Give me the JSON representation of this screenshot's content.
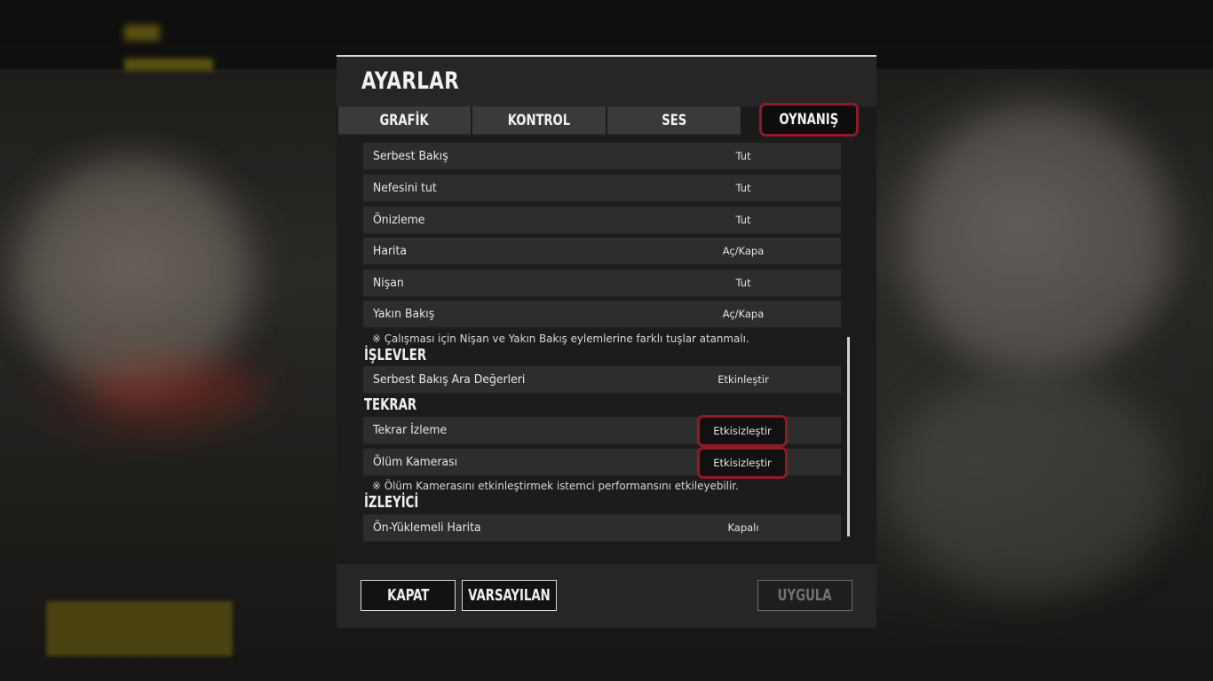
{
  "dialog": {
    "title": "AYARLAR"
  },
  "tabs": [
    {
      "label": "GRAFİK",
      "active": false
    },
    {
      "label": "KONTROL",
      "active": false
    },
    {
      "label": "SES",
      "active": false
    },
    {
      "label": "OYNANIŞ",
      "active": true
    }
  ],
  "rows": [
    {
      "name": "Serbest Bakış",
      "value": "Tut"
    },
    {
      "name": "Nefesini tut",
      "value": "Tut"
    },
    {
      "name": "Önizleme",
      "value": "Tut"
    },
    {
      "name": "Harita",
      "value": "Aç/Kapa"
    },
    {
      "name": "Nişan",
      "value": "Tut"
    },
    {
      "name": "Yakın Bakış",
      "value": "Aç/Kapa"
    }
  ],
  "note1": "※ Çalışması için Nişan ve Yakın Bakış eylemlerine farklı tuşlar atanmalı.",
  "sections": {
    "islevler": {
      "title": "İŞLEVLER",
      "rows": [
        {
          "name": "Serbest Bakış Ara Değerleri",
          "value": "Etkinleştir"
        }
      ]
    },
    "tekrar": {
      "title": "TEKRAR",
      "rows": [
        {
          "name": "Tekrar İzleme",
          "value": "Etkisizleştir"
        },
        {
          "name": "Ölüm Kamerası",
          "value": "Etkisizleştir"
        }
      ]
    },
    "izleyici": {
      "title": "İZLEYİCİ",
      "rows": [
        {
          "name": "Ön-Yüklemeli Harita",
          "value": "Kapalı"
        }
      ]
    }
  },
  "note2": "※ Ölüm Kamerasını etkinleştirmek istemci performansını etkileyebilir.",
  "footer": {
    "close_label": "KAPAT",
    "default_label": "VARSAYILAN",
    "apply_label": "UYGULA"
  },
  "colors": {
    "highlight": "#8e1b2a",
    "panel": "#2d2d2d"
  }
}
